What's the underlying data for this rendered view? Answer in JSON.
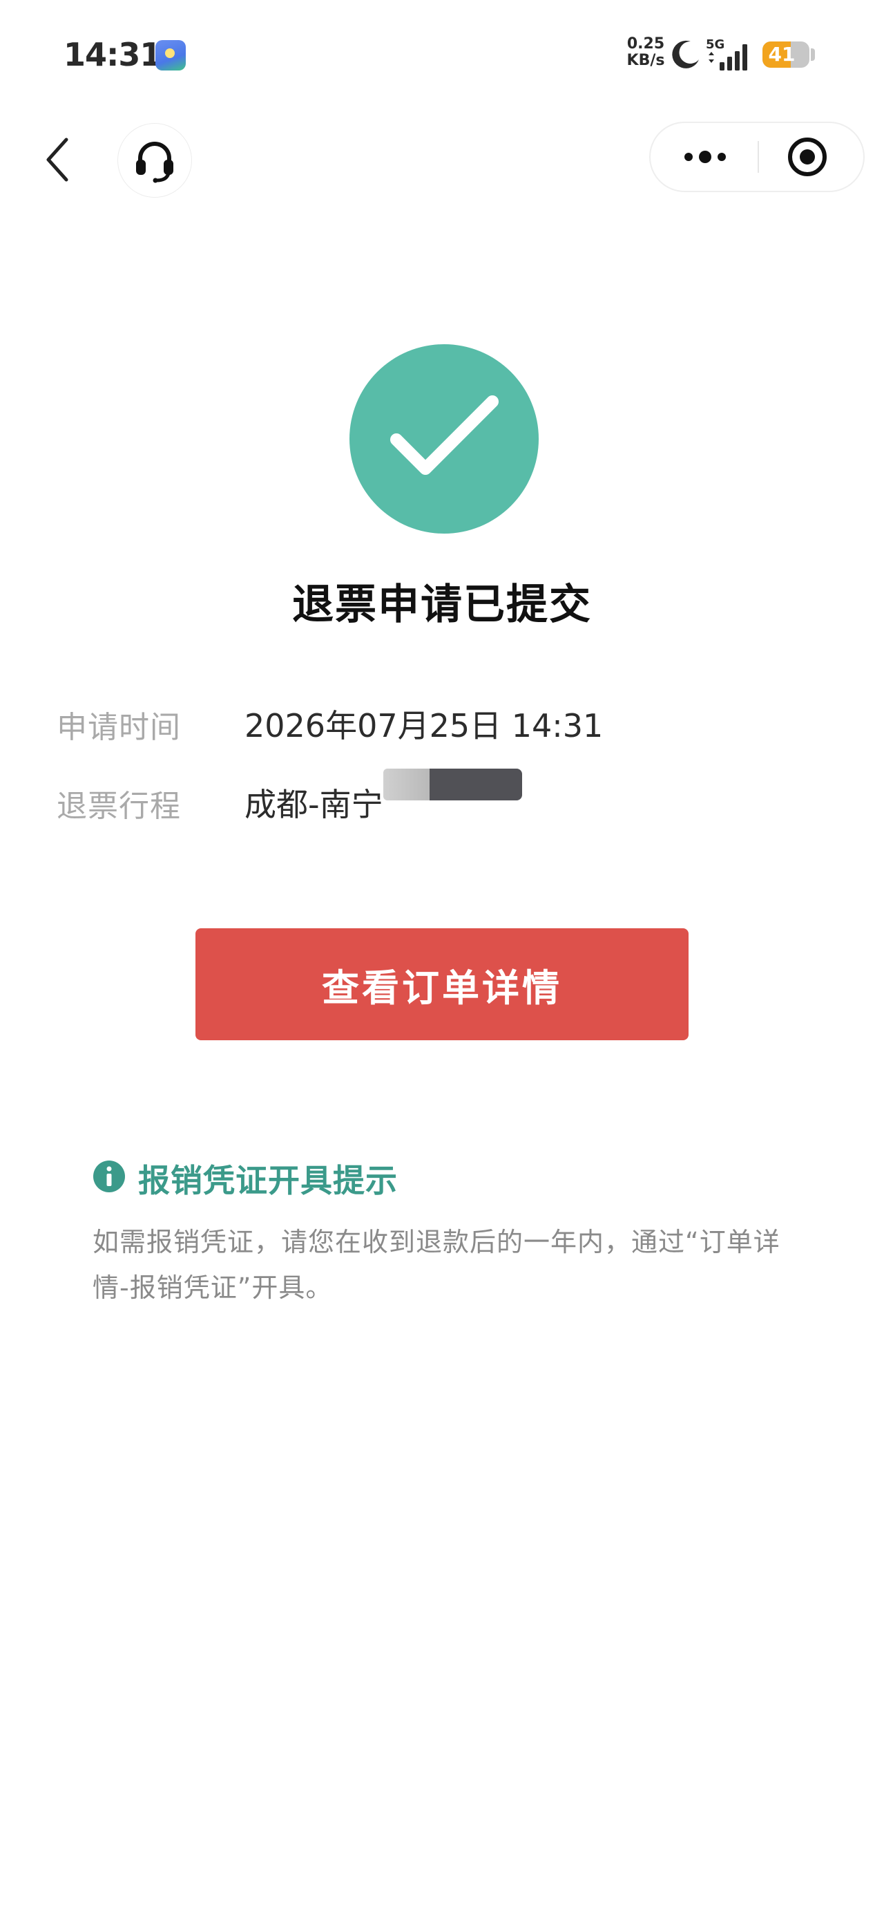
{
  "status_bar": {
    "time": "14:31",
    "net_speed_value": "0.25",
    "net_speed_unit": "KB/s",
    "network_type": "5G",
    "battery_level": "41",
    "battery_fraction": 0.41,
    "icons": [
      "app-icon",
      "moon-icon",
      "signal-icon",
      "battery-icon"
    ]
  },
  "nav": {
    "icons": [
      "back-icon",
      "headset-icon",
      "more-icon",
      "close-target-icon"
    ]
  },
  "success": {
    "title": "退票申请已提交",
    "accent_color": "#58bca8"
  },
  "info": {
    "apply_time_label": "申请时间",
    "apply_time_value": "2026年07月25日 14:31",
    "trip_label": "退票行程",
    "trip_value": "成都-南宁"
  },
  "actions": {
    "view_order_label": "查看订单详情",
    "button_color": "#dd514b"
  },
  "notice": {
    "title": "报销凭证开具提示",
    "body": "如需报销凭证，请您在收到退款后的一年内，通过“订单详情-报销凭证”开具。",
    "color": "#3b9a8a"
  }
}
